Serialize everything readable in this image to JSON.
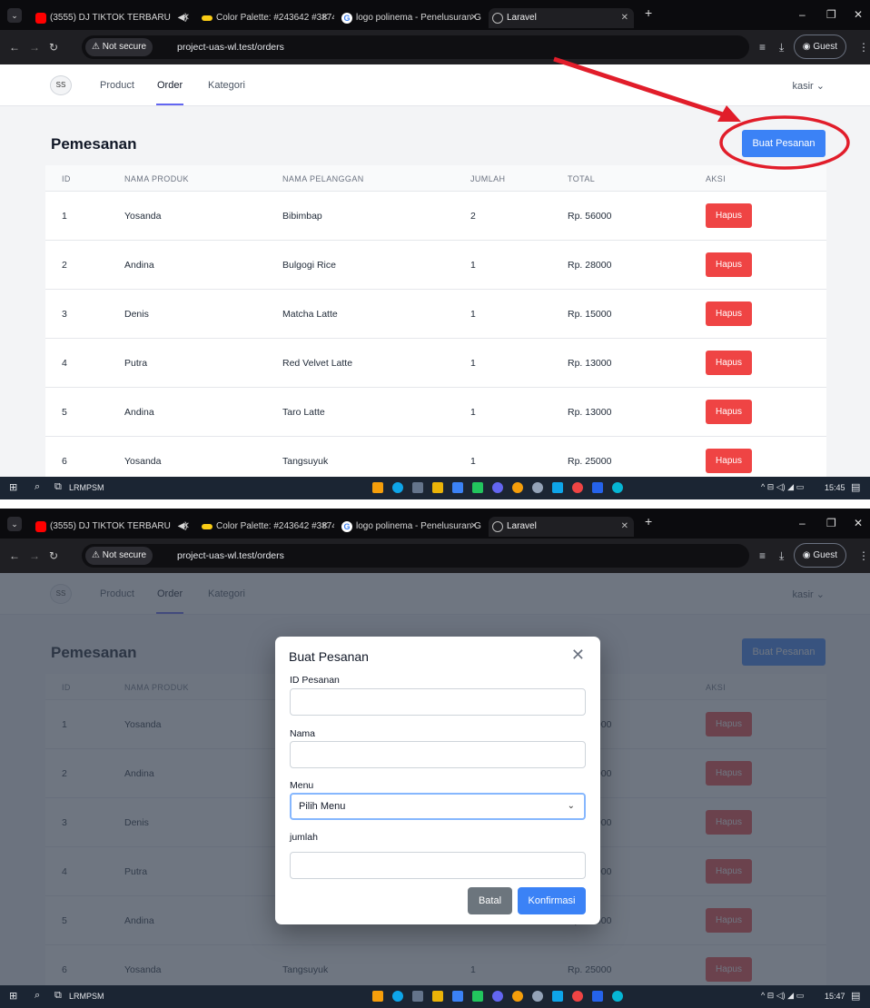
{
  "browser": {
    "tabs": [
      {
        "title": "(3555) DJ TIKTOK TERBARU",
        "icon": "youtube-icon"
      },
      {
        "title": "Color Palette: #243642 #38747",
        "icon": "palette-icon"
      },
      {
        "title": "logo polinema - Penelusuran G",
        "icon": "google-icon"
      },
      {
        "title": "Laravel",
        "icon": "globe-icon"
      }
    ],
    "not_secure": "Not secure",
    "url": "project-uas-wl.test/orders",
    "guest": "Guest",
    "new_tab": "+"
  },
  "nav": {
    "logo_text": "SS",
    "links": [
      "Product",
      "Order",
      "Kategori"
    ],
    "active": "Order",
    "user": "kasir ⌄"
  },
  "page": {
    "title": "Pemesanan",
    "create_button": "Buat Pesanan"
  },
  "table": {
    "headers": [
      "ID",
      "NAMA PRODUK",
      "NAMA PELANGGAN",
      "JUMLAH",
      "TOTAL",
      "AKSI"
    ],
    "rows": [
      {
        "id": "1",
        "produk": "Yosanda",
        "pelanggan": "Bibimbap",
        "jumlah": "2",
        "total": "Rp. 56000",
        "aksi": "Hapus"
      },
      {
        "id": "2",
        "produk": "Andina",
        "pelanggan": "Bulgogi Rice",
        "jumlah": "1",
        "total": "Rp. 28000",
        "aksi": "Hapus"
      },
      {
        "id": "3",
        "produk": "Denis",
        "pelanggan": "Matcha Latte",
        "jumlah": "1",
        "total": "Rp. 15000",
        "aksi": "Hapus"
      },
      {
        "id": "4",
        "produk": "Putra",
        "pelanggan": "Red Velvet Latte",
        "jumlah": "1",
        "total": "Rp. 13000",
        "aksi": "Hapus"
      },
      {
        "id": "5",
        "produk": "Andina",
        "pelanggan": "Taro Latte",
        "jumlah": "1",
        "total": "Rp. 13000",
        "aksi": "Hapus"
      },
      {
        "id": "6",
        "produk": "Yosanda",
        "pelanggan": "Tangsuyuk",
        "jumlah": "1",
        "total": "Rp. 25000",
        "aksi": "Hapus"
      }
    ]
  },
  "taskbar": {
    "label": "LRMPSM",
    "time_1": "15:45",
    "time_2": "15:47"
  },
  "modal": {
    "title": "Buat Pesanan",
    "fields": {
      "id_label": "ID Pesanan",
      "id_value": "",
      "nama_label": "Nama",
      "nama_value": "",
      "menu_label": "Menu",
      "menu_selected": "Pilih Menu",
      "jumlah_label": "jumlah",
      "jumlah_value": ""
    },
    "cancel": "Batal",
    "confirm": "Konfirmasi"
  },
  "colors": {
    "primary": "#3b82f6",
    "danger": "#ef4444",
    "secondary": "#6c757d",
    "annotation": "#e11d2a",
    "nav_active": "#6366f1"
  }
}
